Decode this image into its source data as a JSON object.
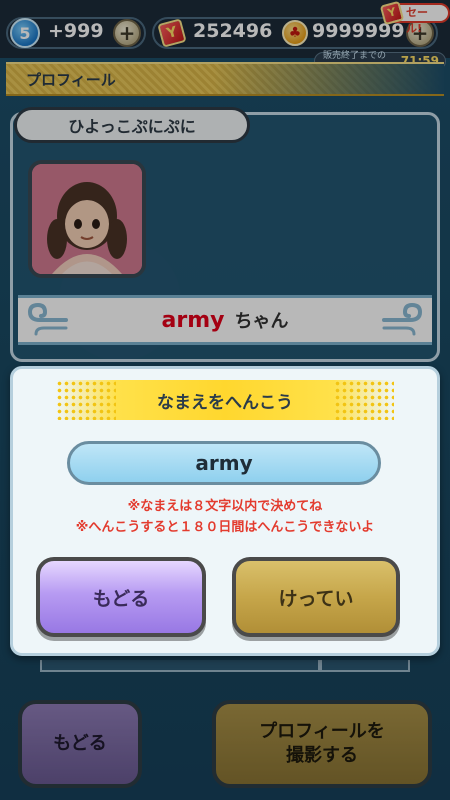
{
  "status_bar": {
    "stamina_level": "5",
    "stamina_count": "+999",
    "plus_symbol": "+",
    "gem_count": "252496",
    "coin_count": "9999999",
    "sale_label": "セール!",
    "sale_timer_label": "販売終了までのこり",
    "sale_timer_value": "71:59",
    "gem_icon_glyph": "Y",
    "coin_icon_glyph": "♣"
  },
  "profile": {
    "header_title": "プロフィール",
    "title_tag": "ひよっこぷにぷに",
    "player_name": "army",
    "honorific": "ちゃん"
  },
  "dialog": {
    "title": "なまえをへんこう",
    "name_value": "army",
    "notice_1": "※なまえは８文字以内で決めてね",
    "notice_2": "※へんこうすると１８０日間はへんこうできないよ",
    "back_label": "もどる",
    "confirm_label": "けってい"
  },
  "bottom": {
    "back_label": "もどる",
    "photo_label_line1": "プロフィールを",
    "photo_label_line2": "撮影する"
  },
  "colors": {
    "accent_yellow": "#ffd72e",
    "name_red": "#e3001a",
    "notice_red": "#e33b2e",
    "back_button_purple": "#b79bf2",
    "confirm_button_gold": "#c6a64a"
  }
}
